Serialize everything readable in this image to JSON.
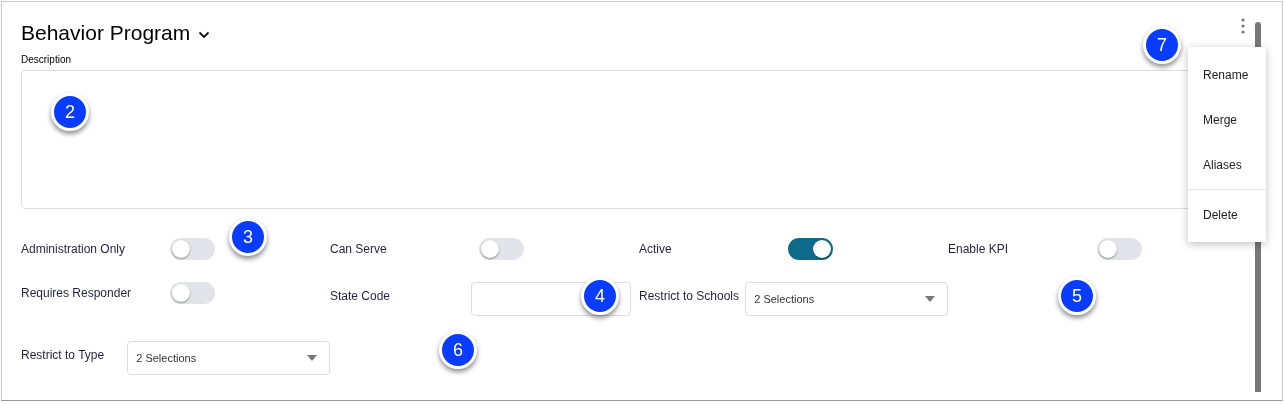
{
  "header": {
    "title": "Behavior Program"
  },
  "description": {
    "label": "Description"
  },
  "rows": [
    [
      {
        "kind": "toggle",
        "label": "Administration Only",
        "on": false
      },
      {
        "kind": "toggle",
        "label": "Can Serve",
        "on": false
      },
      {
        "kind": "toggle",
        "label": "Active",
        "on": true
      },
      {
        "kind": "toggle",
        "label": "Enable KPI",
        "on": false
      }
    ],
    [
      {
        "kind": "toggle",
        "label": "Requires Responder",
        "on": false
      },
      {
        "kind": "input",
        "label": "State Code"
      },
      {
        "kind": "select",
        "label": "Restrict to Schools",
        "value": "2 Selections"
      }
    ],
    [
      {
        "kind": "select",
        "label": "Restrict to Type",
        "value": "2 Selections"
      }
    ]
  ],
  "menu": {
    "items": [
      {
        "label": "Rename"
      },
      {
        "label": "Merge"
      },
      {
        "label": "Aliases"
      },
      {
        "label": "Delete"
      }
    ]
  },
  "markers": [
    {
      "label": "2"
    },
    {
      "label": "3"
    },
    {
      "label": "4"
    },
    {
      "label": "5"
    },
    {
      "label": "6"
    },
    {
      "label": "7"
    }
  ]
}
